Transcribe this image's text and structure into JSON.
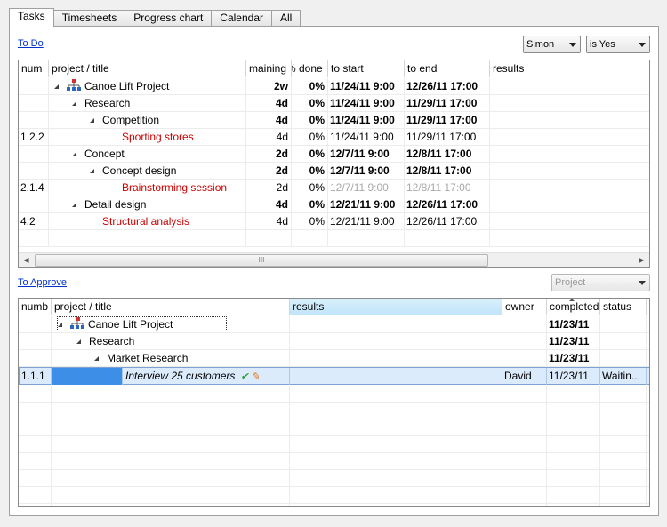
{
  "tabs": [
    "Tasks",
    "Timesheets",
    "Progress chart",
    "Calendar",
    "All"
  ],
  "todo": {
    "link": "To Do",
    "filter_user": "Simon",
    "filter_cond": "is Yes",
    "columns": [
      "num",
      "project / title",
      "maining",
      "% done",
      "to start",
      "to end",
      "results"
    ],
    "rows": [
      {
        "num": "",
        "title": "Canoe Lift Project",
        "remaining": "2w",
        "done": "0%",
        "start": "11/24/11 9:00",
        "end": "12/26/11 17:00"
      },
      {
        "num": "",
        "title": "Research",
        "remaining": "4d",
        "done": "0%",
        "start": "11/24/11 9:00",
        "end": "11/29/11 17:00"
      },
      {
        "num": "",
        "title": "Competition",
        "remaining": "4d",
        "done": "0%",
        "start": "11/24/11 9:00",
        "end": "11/29/11 17:00"
      },
      {
        "num": "1.2.2",
        "title": "Sporting stores",
        "remaining": "4d",
        "done": "0%",
        "start": "11/24/11 9:00",
        "end": "11/29/11 17:00"
      },
      {
        "num": "",
        "title": "Concept",
        "remaining": "2d",
        "done": "0%",
        "start": "12/7/11 9:00",
        "end": "12/8/11 17:00"
      },
      {
        "num": "",
        "title": "Concept design",
        "remaining": "2d",
        "done": "0%",
        "start": "12/7/11 9:00",
        "end": "12/8/11 17:00"
      },
      {
        "num": "2.1.4",
        "title": "Brainstorming session",
        "remaining": "2d",
        "done": "0%",
        "start": "12/7/11 9:00",
        "end": "12/8/11 17:00"
      },
      {
        "num": "",
        "title": "Detail design",
        "remaining": "4d",
        "done": "0%",
        "start": "12/21/11 9:00",
        "end": "12/26/11 17:00"
      },
      {
        "num": "4.2",
        "title": "Structural analysis",
        "remaining": "4d",
        "done": "0%",
        "start": "12/21/11 9:00",
        "end": "12/26/11 17:00"
      }
    ],
    "scroll_grip": "III"
  },
  "approve": {
    "link": "To Approve",
    "filter": "Project",
    "columns": [
      "numb",
      "project / title",
      "results",
      "owner",
      "completed",
      "status"
    ],
    "rows": [
      {
        "num": "",
        "title": "Canoe Lift Project",
        "owner": "",
        "completed": "11/23/11",
        "status": ""
      },
      {
        "num": "",
        "title": "Research",
        "owner": "",
        "completed": "11/23/11",
        "status": ""
      },
      {
        "num": "",
        "title": "Market Research",
        "owner": "",
        "completed": "11/23/11",
        "status": ""
      },
      {
        "num": "1.1.1",
        "title": "Interview 25 customers",
        "owner": "David",
        "completed": "11/23/11",
        "status": "Waitin..."
      }
    ]
  },
  "colors": {
    "accent_red": "#cc0000",
    "selection": "#dcebfc",
    "link": "#0033cc"
  }
}
